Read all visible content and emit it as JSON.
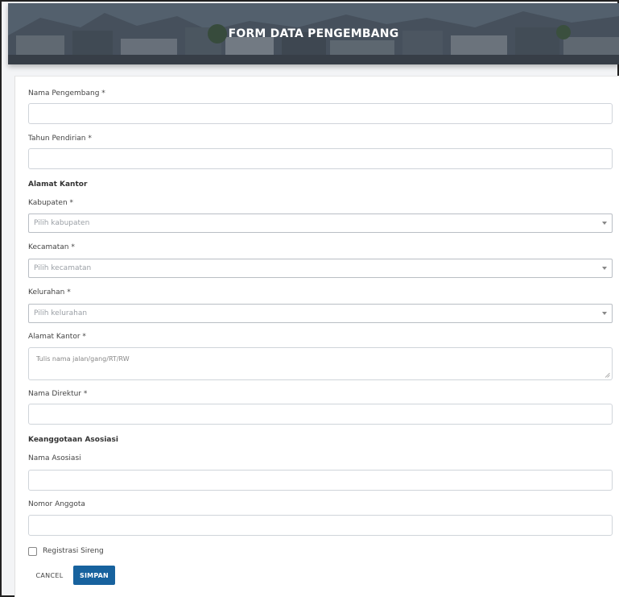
{
  "banner": {
    "title": "FORM DATA PENGEMBANG"
  },
  "form": {
    "nama_pengembang": {
      "label": "Nama Pengembang *",
      "value": ""
    },
    "tahun_pendirian": {
      "label": "Tahun Pendirian *",
      "value": ""
    },
    "section_alamat": "Alamat Kantor",
    "kabupaten": {
      "label": "Kabupaten *",
      "placeholder": "Pilih kabupaten"
    },
    "kecamatan": {
      "label": "Kecamatan *",
      "placeholder": "Pilih kecamatan"
    },
    "kelurahan": {
      "label": "Kelurahan *",
      "placeholder": "Pilih kelurahan"
    },
    "alamat_kantor": {
      "label": "Alamat Kantor *",
      "placeholder": "Tulis nama jalan/gang/RT/RW"
    },
    "nama_direktur": {
      "label": "Nama Direktur *",
      "value": ""
    },
    "section_asosiasi": "Keanggotaan Asosiasi",
    "nama_asosiasi": {
      "label": "Nama Asosiasi",
      "value": ""
    },
    "nomor_anggota": {
      "label": "Nomor Anggota",
      "value": ""
    },
    "registrasi_sireng": {
      "label": "Registrasi Sireng",
      "checked": false
    }
  },
  "actions": {
    "cancel_label": "CANCEL",
    "save_label": "SIMPAN"
  },
  "colors": {
    "primary": "#17629e",
    "border": "#cfd4da",
    "placeholder": "#9a9fa5"
  }
}
